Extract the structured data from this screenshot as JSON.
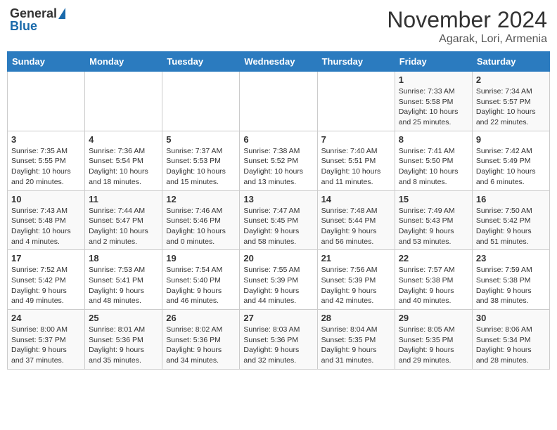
{
  "header": {
    "logo_general": "General",
    "logo_blue": "Blue",
    "month": "November 2024",
    "location": "Agarak, Lori, Armenia"
  },
  "weekdays": [
    "Sunday",
    "Monday",
    "Tuesday",
    "Wednesday",
    "Thursday",
    "Friday",
    "Saturday"
  ],
  "weeks": [
    [
      {
        "day": "",
        "info": ""
      },
      {
        "day": "",
        "info": ""
      },
      {
        "day": "",
        "info": ""
      },
      {
        "day": "",
        "info": ""
      },
      {
        "day": "",
        "info": ""
      },
      {
        "day": "1",
        "info": "Sunrise: 7:33 AM\nSunset: 5:58 PM\nDaylight: 10 hours\nand 25 minutes."
      },
      {
        "day": "2",
        "info": "Sunrise: 7:34 AM\nSunset: 5:57 PM\nDaylight: 10 hours\nand 22 minutes."
      }
    ],
    [
      {
        "day": "3",
        "info": "Sunrise: 7:35 AM\nSunset: 5:55 PM\nDaylight: 10 hours\nand 20 minutes."
      },
      {
        "day": "4",
        "info": "Sunrise: 7:36 AM\nSunset: 5:54 PM\nDaylight: 10 hours\nand 18 minutes."
      },
      {
        "day": "5",
        "info": "Sunrise: 7:37 AM\nSunset: 5:53 PM\nDaylight: 10 hours\nand 15 minutes."
      },
      {
        "day": "6",
        "info": "Sunrise: 7:38 AM\nSunset: 5:52 PM\nDaylight: 10 hours\nand 13 minutes."
      },
      {
        "day": "7",
        "info": "Sunrise: 7:40 AM\nSunset: 5:51 PM\nDaylight: 10 hours\nand 11 minutes."
      },
      {
        "day": "8",
        "info": "Sunrise: 7:41 AM\nSunset: 5:50 PM\nDaylight: 10 hours\nand 8 minutes."
      },
      {
        "day": "9",
        "info": "Sunrise: 7:42 AM\nSunset: 5:49 PM\nDaylight: 10 hours\nand 6 minutes."
      }
    ],
    [
      {
        "day": "10",
        "info": "Sunrise: 7:43 AM\nSunset: 5:48 PM\nDaylight: 10 hours\nand 4 minutes."
      },
      {
        "day": "11",
        "info": "Sunrise: 7:44 AM\nSunset: 5:47 PM\nDaylight: 10 hours\nand 2 minutes."
      },
      {
        "day": "12",
        "info": "Sunrise: 7:46 AM\nSunset: 5:46 PM\nDaylight: 10 hours\nand 0 minutes."
      },
      {
        "day": "13",
        "info": "Sunrise: 7:47 AM\nSunset: 5:45 PM\nDaylight: 9 hours\nand 58 minutes."
      },
      {
        "day": "14",
        "info": "Sunrise: 7:48 AM\nSunset: 5:44 PM\nDaylight: 9 hours\nand 56 minutes."
      },
      {
        "day": "15",
        "info": "Sunrise: 7:49 AM\nSunset: 5:43 PM\nDaylight: 9 hours\nand 53 minutes."
      },
      {
        "day": "16",
        "info": "Sunrise: 7:50 AM\nSunset: 5:42 PM\nDaylight: 9 hours\nand 51 minutes."
      }
    ],
    [
      {
        "day": "17",
        "info": "Sunrise: 7:52 AM\nSunset: 5:42 PM\nDaylight: 9 hours\nand 49 minutes."
      },
      {
        "day": "18",
        "info": "Sunrise: 7:53 AM\nSunset: 5:41 PM\nDaylight: 9 hours\nand 48 minutes."
      },
      {
        "day": "19",
        "info": "Sunrise: 7:54 AM\nSunset: 5:40 PM\nDaylight: 9 hours\nand 46 minutes."
      },
      {
        "day": "20",
        "info": "Sunrise: 7:55 AM\nSunset: 5:39 PM\nDaylight: 9 hours\nand 44 minutes."
      },
      {
        "day": "21",
        "info": "Sunrise: 7:56 AM\nSunset: 5:39 PM\nDaylight: 9 hours\nand 42 minutes."
      },
      {
        "day": "22",
        "info": "Sunrise: 7:57 AM\nSunset: 5:38 PM\nDaylight: 9 hours\nand 40 minutes."
      },
      {
        "day": "23",
        "info": "Sunrise: 7:59 AM\nSunset: 5:38 PM\nDaylight: 9 hours\nand 38 minutes."
      }
    ],
    [
      {
        "day": "24",
        "info": "Sunrise: 8:00 AM\nSunset: 5:37 PM\nDaylight: 9 hours\nand 37 minutes."
      },
      {
        "day": "25",
        "info": "Sunrise: 8:01 AM\nSunset: 5:36 PM\nDaylight: 9 hours\nand 35 minutes."
      },
      {
        "day": "26",
        "info": "Sunrise: 8:02 AM\nSunset: 5:36 PM\nDaylight: 9 hours\nand 34 minutes."
      },
      {
        "day": "27",
        "info": "Sunrise: 8:03 AM\nSunset: 5:36 PM\nDaylight: 9 hours\nand 32 minutes."
      },
      {
        "day": "28",
        "info": "Sunrise: 8:04 AM\nSunset: 5:35 PM\nDaylight: 9 hours\nand 31 minutes."
      },
      {
        "day": "29",
        "info": "Sunrise: 8:05 AM\nSunset: 5:35 PM\nDaylight: 9 hours\nand 29 minutes."
      },
      {
        "day": "30",
        "info": "Sunrise: 8:06 AM\nSunset: 5:34 PM\nDaylight: 9 hours\nand 28 minutes."
      }
    ]
  ]
}
